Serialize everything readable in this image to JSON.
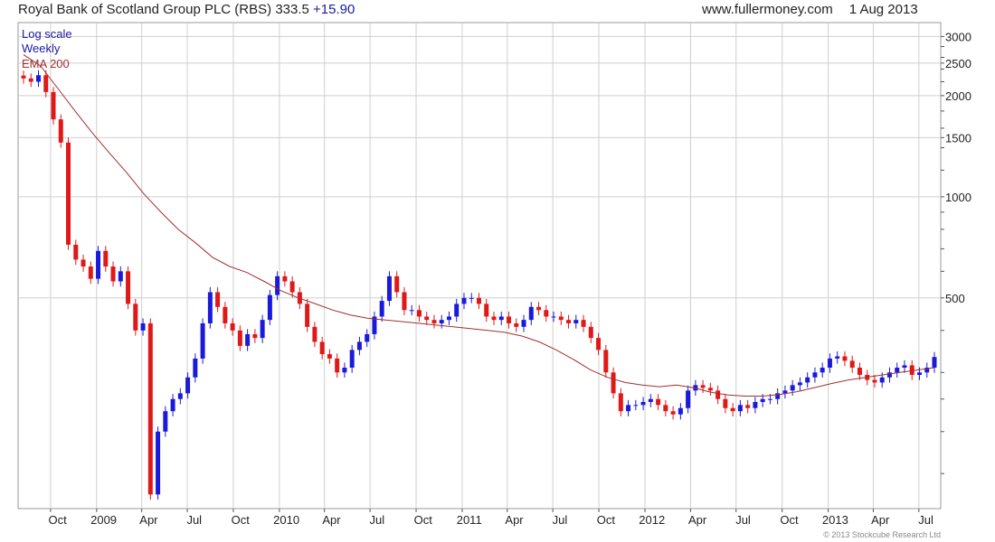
{
  "header": {
    "company": "Royal Bank of Scotland Group PLC (RBS)",
    "price": "333.5",
    "change": "+15.90",
    "site": "www.fullermoney.com",
    "date": "1 Aug 2013"
  },
  "legend": {
    "scale": "Log scale",
    "period": "Weekly",
    "ema": "EMA 200"
  },
  "copyright": "© 2013 Stockcube Research Ltd",
  "colors": {
    "up": "#1a1adb",
    "down": "#e01818",
    "ema": "#a03030",
    "grid": "#cfcfcf",
    "legend_blue": "#1a1aa0",
    "legend_red": "#a03030"
  },
  "chart_data": {
    "type": "line",
    "series": [
      {
        "name": "RBS weekly price",
        "style": "candlestick",
        "x_range": [
          "2008-08-08",
          "2013-08-01"
        ],
        "values": [
          2250,
          2200,
          2300,
          2050,
          1700,
          1450,
          720,
          650,
          620,
          570,
          690,
          620,
          560,
          600,
          480,
          400,
          420,
          130,
          200,
          230,
          250,
          260,
          290,
          330,
          420,
          520,
          470,
          420,
          400,
          360,
          390,
          380,
          430,
          510,
          580,
          560,
          520,
          480,
          410,
          370,
          340,
          330,
          300,
          310,
          350,
          370,
          390,
          440,
          490,
          580,
          520,
          460,
          460,
          440,
          430,
          420,
          430,
          440,
          480,
          500,
          500,
          480,
          440,
          430,
          440,
          420,
          410,
          430,
          470,
          460,
          440,
          440,
          430,
          420,
          430,
          410,
          380,
          350,
          300,
          260,
          230,
          240,
          240,
          245,
          250,
          240,
          230,
          225,
          235,
          265,
          275,
          270,
          265,
          250,
          235,
          230,
          240,
          235,
          245,
          250,
          250,
          260,
          265,
          275,
          280,
          290,
          300,
          310,
          330,
          335,
          325,
          310,
          295,
          285,
          280,
          290,
          300,
          310,
          315,
          295,
          300,
          310,
          333.5
        ]
      },
      {
        "name": "EMA 200",
        "x_range": [
          "2008-08-08",
          "2013-08-01"
        ],
        "values": [
          2650,
          2450,
          2100,
          1800,
          1550,
          1350,
          1180,
          1020,
          900,
          800,
          730,
          660,
          620,
          595,
          560,
          525,
          500,
          480,
          460,
          445,
          435,
          430,
          425,
          420,
          415,
          410,
          405,
          400,
          395,
          385,
          370,
          350,
          328,
          305,
          290,
          280,
          275,
          272,
          275,
          270,
          262,
          257,
          255,
          255,
          258,
          263,
          270,
          278,
          285,
          290,
          295,
          300,
          305,
          310
        ]
      }
    ],
    "x_tick_labels": [
      "Oct",
      "2009",
      "Apr",
      "Jul",
      "Oct",
      "2010",
      "Apr",
      "Jul",
      "Oct",
      "2011",
      "Apr",
      "Jul",
      "Oct",
      "2012",
      "Apr",
      "Jul",
      "Oct",
      "2013",
      "Apr",
      "Jul"
    ],
    "y_tick_labels": [
      "3000",
      "2500",
      "2000",
      "1500",
      "1000",
      "500"
    ],
    "y_ticks": [
      3000,
      2500,
      2000,
      1500,
      1000,
      500
    ],
    "ylim": [
      118,
      3300
    ],
    "y_scale": "log",
    "y_axis_side": "right",
    "grid": true,
    "legend_placement": "top-left"
  }
}
